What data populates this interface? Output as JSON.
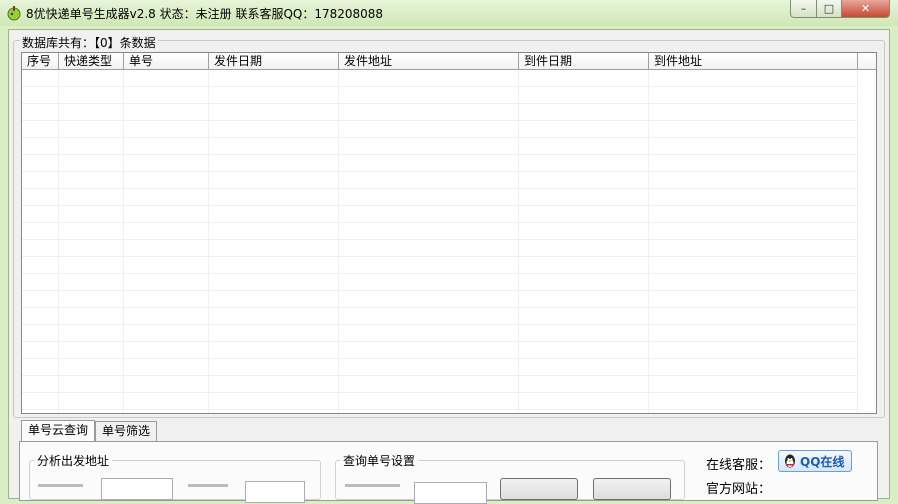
{
  "window": {
    "title": "8优快递单号生成器v2.8  状态：未注册   联系客服QQ：178208088",
    "minimize_icon": "minimize-icon",
    "maximize_icon": "maximize-icon",
    "close_icon": "close-icon"
  },
  "database": {
    "count_label": "数据库共有：【0】条数据"
  },
  "table": {
    "columns": [
      "序号",
      "快递类型",
      "单号",
      "发件日期",
      "发件地址",
      "到件日期",
      "到件地址"
    ],
    "rows": []
  },
  "tabs": [
    {
      "label": "单号云查询",
      "active": true
    },
    {
      "label": "单号筛选",
      "active": false
    }
  ],
  "panel": {
    "analyze_title": "分析出发地址",
    "query_title": "查询单号设置",
    "online_service_label": "在线客服：",
    "qq_button_label": "QQ在线",
    "website_label": "官方网站："
  },
  "colors": {
    "frame": "#d9eec3",
    "accent": "#1a5db6"
  }
}
